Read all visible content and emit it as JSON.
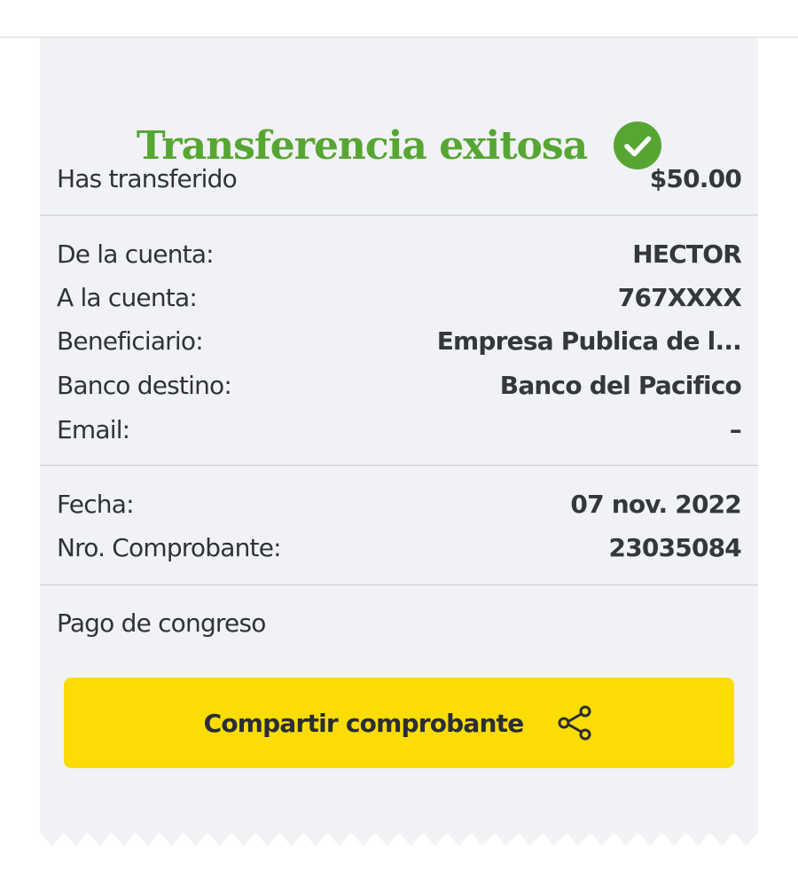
{
  "receipt": {
    "title": "Transferencia exitosa",
    "status_icon": "check-circle-icon",
    "amount": {
      "label": "Has transferido",
      "value": "$50.00"
    },
    "accounts": [
      {
        "label": "De la cuenta:",
        "value": "HECTOR"
      },
      {
        "label": "A la cuenta:",
        "value": "767XXXX"
      },
      {
        "label": "Beneficiario:",
        "value": "Empresa Publica de l..."
      },
      {
        "label": "Banco destino:",
        "value": "Banco del Pacifico"
      },
      {
        "label": "Email:",
        "value": "–"
      }
    ],
    "details": [
      {
        "label": "Fecha:",
        "value": "07 nov. 2022"
      },
      {
        "label": "Nro. Comprobante:",
        "value": "23035084"
      }
    ],
    "note": "Pago de congreso",
    "share_button": {
      "label": "Compartir comprobante",
      "icon": "share-icon"
    }
  },
  "colors": {
    "title_green": "#57a633",
    "button_yellow": "#fbdc05",
    "receipt_background": "#f1f2f5"
  }
}
